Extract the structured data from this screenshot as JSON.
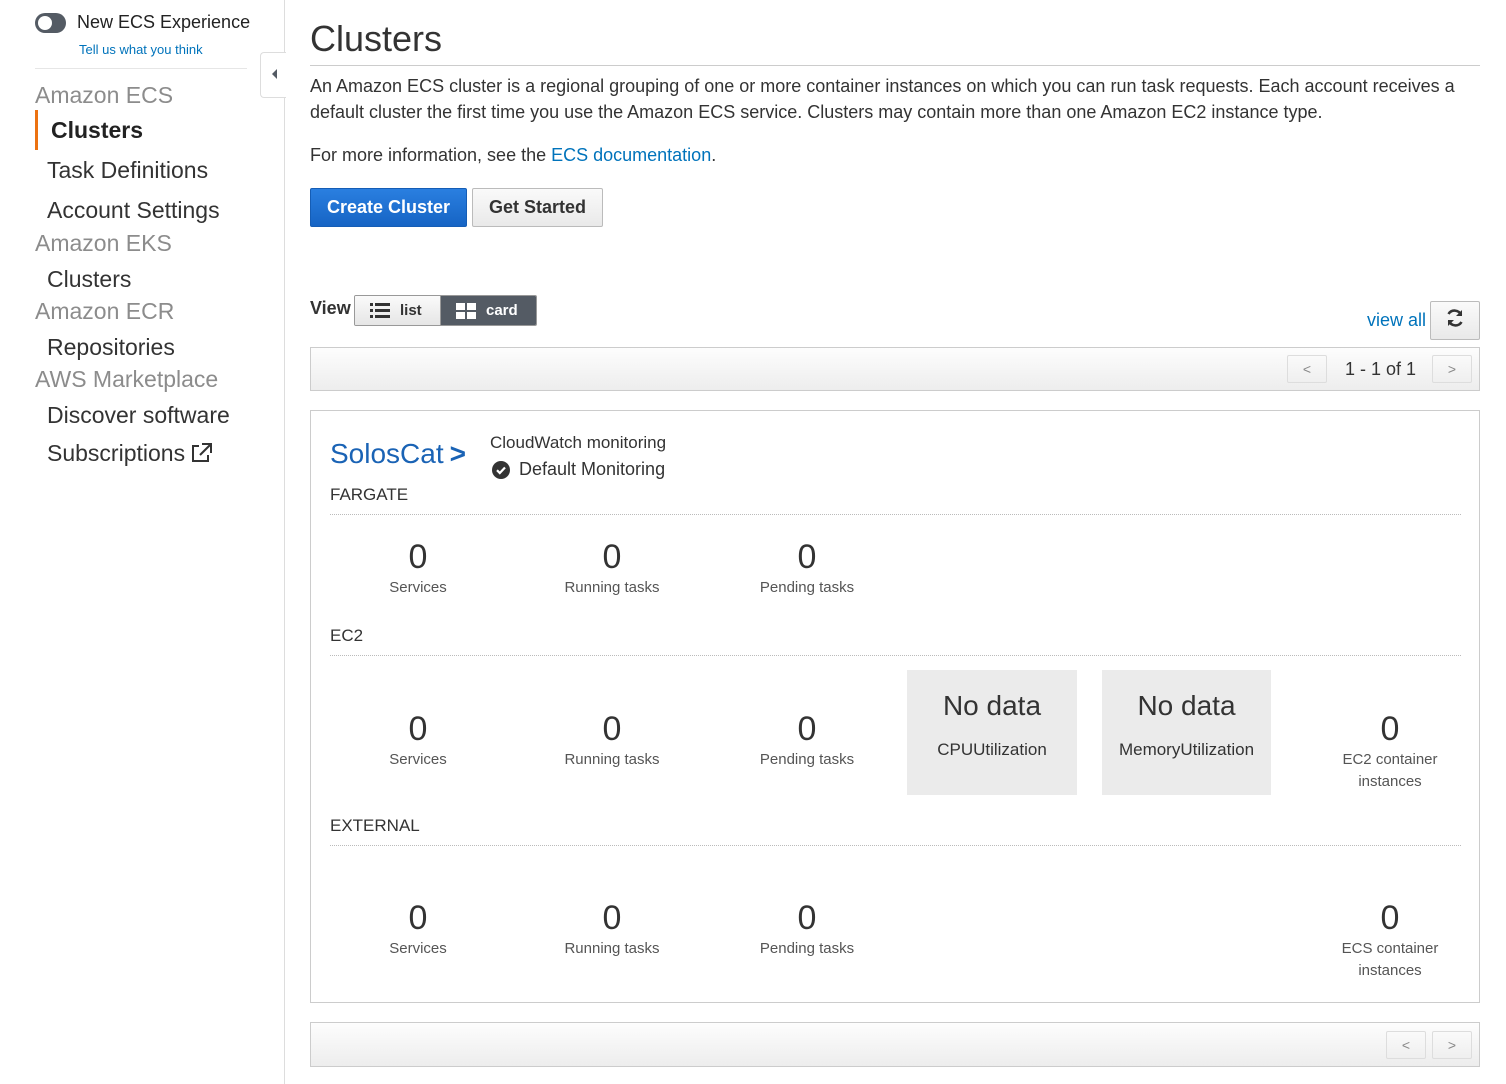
{
  "sidebar": {
    "toggle_label": "New ECS Experience",
    "feedback_link": "Tell us what you think",
    "sections": [
      {
        "title": "Amazon ECS",
        "items": [
          "Clusters",
          "Task Definitions",
          "Account Settings"
        ]
      },
      {
        "title": "Amazon EKS",
        "items": [
          "Clusters"
        ]
      },
      {
        "title": "Amazon ECR",
        "items": [
          "Repositories"
        ]
      },
      {
        "title": "AWS Marketplace",
        "items": [
          "Discover software",
          "Subscriptions"
        ]
      }
    ],
    "collapse_icon": "caret-left-icon"
  },
  "main": {
    "title": "Clusters",
    "description": "An Amazon ECS cluster is a regional grouping of one or more container instances on which you can run task requests. Each account receives a default cluster the first time you use the Amazon ECS service. Clusters may contain more than one Amazon EC2 instance type.",
    "more_info_prefix": "For more information, see the ",
    "more_info_link": "ECS documentation",
    "more_info_suffix": ".",
    "create_button": "Create Cluster",
    "get_started_button": "Get Started",
    "view_label": "View",
    "view_list": "list",
    "view_card": "card",
    "view_all": "view all",
    "pager_prev": "<",
    "pager_next": ">",
    "pager_count": "1 - 1 of 1"
  },
  "cluster": {
    "name": "SolosCat",
    "chevron": ">",
    "cloudwatch_title": "CloudWatch monitoring",
    "cloudwatch_status": "Default Monitoring",
    "fargate": {
      "label": "FARGATE",
      "services": "0",
      "services_label": "Services",
      "running": "0",
      "running_label": "Running tasks",
      "pending": "0",
      "pending_label": "Pending tasks"
    },
    "ec2": {
      "label": "EC2",
      "services": "0",
      "services_label": "Services",
      "running": "0",
      "running_label": "Running tasks",
      "pending": "0",
      "pending_label": "Pending tasks",
      "cpu_value": "No data",
      "cpu_label": "CPUUtilization",
      "mem_value": "No data",
      "mem_label": "MemoryUtilization",
      "instances": "0",
      "instances_label_1": "EC2 container",
      "instances_label_2": "instances"
    },
    "external": {
      "label": "EXTERNAL",
      "services": "0",
      "services_label": "Services",
      "running": "0",
      "running_label": "Running tasks",
      "pending": "0",
      "pending_label": "Pending tasks",
      "instances": "0",
      "instances_label_1": "ECS container",
      "instances_label_2": "instances"
    }
  },
  "colors": {
    "accent_orange": "#ec7211",
    "link_blue": "#0073bb",
    "primary_button": "#1f6fd1",
    "toggle_dark": "#545b64"
  }
}
